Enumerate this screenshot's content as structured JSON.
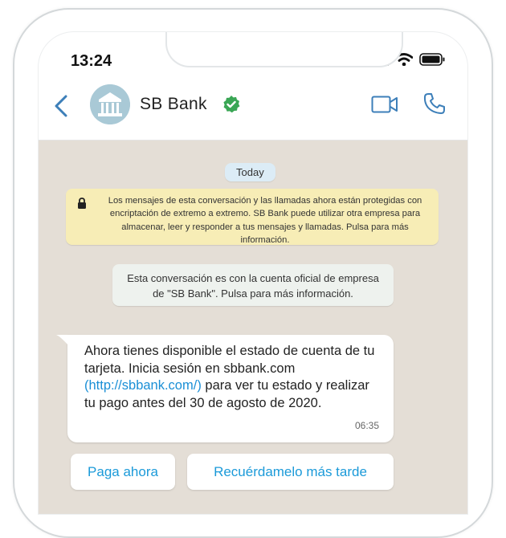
{
  "status_bar": {
    "time": "13:24",
    "icons": [
      "signal-icon",
      "wifi-icon",
      "battery-icon"
    ]
  },
  "header": {
    "title": "SB Bank",
    "icons": [
      "back-arrow-icon",
      "bank-avatar-icon",
      "verified-check-icon",
      "video-call-icon",
      "phone-call-icon"
    ]
  },
  "chat": {
    "date_label": "Today",
    "encryption_notice": "Los mensajes de esta conversación y las llamadas ahora están protegidas con encriptación de extremo a extremo. SB Bank puede utilizar otra empresa para almacenar, leer y responder a tus mensajes y llamadas. Pulsa para más información.",
    "business_notice": "Esta conversación es con la cuenta oficial de empresa de \"SB Bank\". Pulsa para más información.",
    "message": {
      "text_before_link": "Ahora tienes disponible el estado de cuenta de tu tarjeta. Inicia sesión en sbbank.com ",
      "link": "(http://sbbank.com/)",
      "text_after_link": " para ver tu estado y realizar tu pago antes del 30 de agosto de 2020.",
      "time": "06:35"
    },
    "quick_replies": [
      "Paga ahora",
      "Recuérdamelo más tarde"
    ]
  },
  "colors": {
    "accent_blue": "#1b9ad9",
    "header_icon_blue": "#3d7fb9",
    "verified_green": "#3aa655",
    "chat_background": "#e4ded6",
    "encryption_notice_bg": "#f7edb6",
    "date_pill_bg": "#dcecf6"
  }
}
